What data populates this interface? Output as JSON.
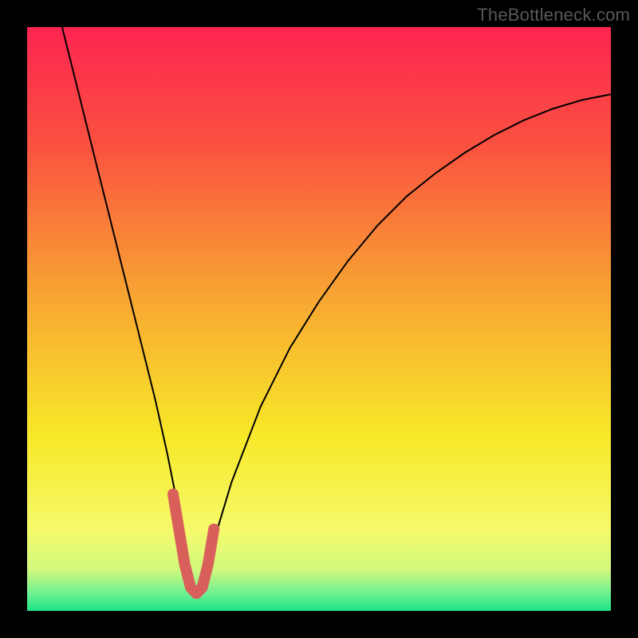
{
  "watermark": "TheBottleneck.com",
  "gradient": {
    "stops": [
      {
        "pct": 0,
        "color": "#fd2551"
      },
      {
        "pct": 20,
        "color": "#fa5140"
      },
      {
        "pct": 45,
        "color": "#f8a233"
      },
      {
        "pct": 70,
        "color": "#f7e828"
      },
      {
        "pct": 86,
        "color": "#f6fa6a"
      },
      {
        "pct": 93,
        "color": "#d0f97d"
      },
      {
        "pct": 97,
        "color": "#6ef091"
      },
      {
        "pct": 100,
        "color": "#1be587"
      }
    ]
  },
  "chart_data": {
    "type": "line",
    "title": "",
    "xlabel": "",
    "ylabel": "",
    "xlim": [
      0,
      100
    ],
    "ylim": [
      0,
      100
    ],
    "series": [
      {
        "name": "bottleneck-curve",
        "x": [
          6,
          8,
          10,
          12,
          14,
          16,
          18,
          20,
          22,
          24,
          26,
          27,
          28,
          29,
          30,
          32,
          35,
          40,
          45,
          50,
          55,
          60,
          65,
          70,
          75,
          80,
          85,
          90,
          95,
          100
        ],
        "values": [
          100,
          92,
          84,
          76,
          68,
          60,
          52,
          44,
          36,
          27,
          17,
          10,
          5,
          3,
          5,
          12,
          22,
          35,
          45,
          53,
          60,
          66,
          71,
          75,
          78.5,
          81.5,
          84,
          86,
          87.5,
          88.5
        ]
      },
      {
        "name": "valley-highlight",
        "x": [
          25,
          26,
          27,
          28,
          29,
          30,
          31,
          32
        ],
        "values": [
          20,
          14,
          8,
          4,
          3,
          4,
          8,
          14
        ]
      }
    ],
    "annotations": []
  }
}
